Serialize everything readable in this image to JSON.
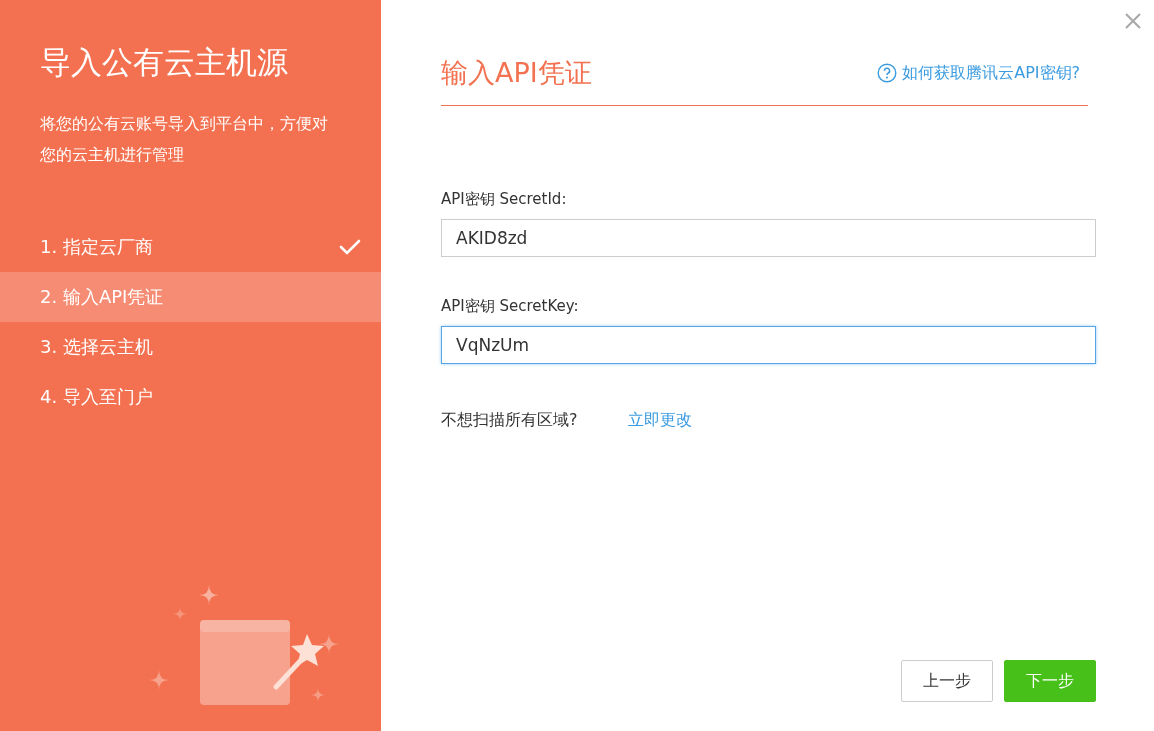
{
  "sidebar": {
    "title": "导入公有云主机源",
    "description": "将您的公有云账号导入到平台中，方便对您的云主机进行管理",
    "steps": [
      {
        "label": "1. 指定云厂商",
        "done": true,
        "selected": false
      },
      {
        "label": "2. 输入API凭证",
        "done": false,
        "selected": true
      },
      {
        "label": "3. 选择云主机",
        "done": false,
        "selected": false
      },
      {
        "label": "4. 导入至门户",
        "done": false,
        "selected": false
      }
    ]
  },
  "main": {
    "heading": "输入API凭证",
    "help_link": "如何获取腾讯云API密钥?",
    "fields": [
      {
        "label": "API密钥 SecretId:",
        "value": "AKID8zd",
        "focused": false
      },
      {
        "label": "API密钥 SecretKey:",
        "value": "VqNzUm",
        "focused": true
      }
    ],
    "region_prompt": "不想扫描所有区域?",
    "region_link": "立即更改",
    "buttons": [
      {
        "label": "上一步",
        "kind": "secondary"
      },
      {
        "label": "下一步",
        "kind": "primary"
      }
    ]
  }
}
